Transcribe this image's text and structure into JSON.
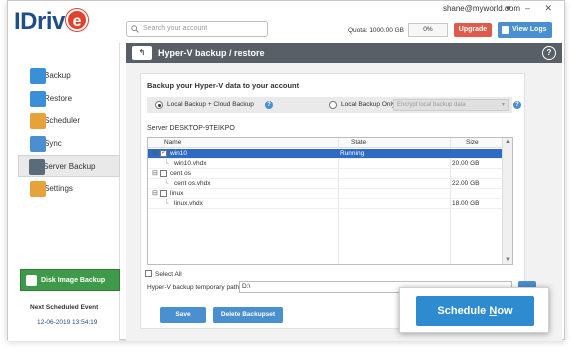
{
  "app": {
    "logo": "IDriv",
    "logo_e": "e"
  },
  "search": {
    "placeholder": "Search your account"
  },
  "account": {
    "email": "shane@myworld.com",
    "window_controls": "▾ – ✕"
  },
  "quota": {
    "label": "Quota: 1000.00 GB",
    "percent": "0%"
  },
  "buttons": {
    "upgrade": "Upgrade",
    "view_logs": "View Logs"
  },
  "sidebar": {
    "items": [
      {
        "label": "Backup",
        "icon": "backup-icon",
        "color": "#3a8fd6"
      },
      {
        "label": "Restore",
        "icon": "restore-icon",
        "color": "#3a8fd6"
      },
      {
        "label": "Scheduler",
        "icon": "scheduler-icon",
        "color": "#e7a23a"
      },
      {
        "label": "Sync",
        "icon": "sync-icon",
        "color": "#4a8fd0"
      },
      {
        "label": "Server Backup",
        "icon": "server-icon",
        "color": "#5a6b7a",
        "active": true
      },
      {
        "label": "Settings",
        "icon": "gear-icon",
        "color": "#e7a23a"
      }
    ],
    "disk_image": "Disk Image Backup",
    "next_scheduled_label": "Next Scheduled Event",
    "next_scheduled_date": "12-06-2019 13:54:19"
  },
  "header": {
    "title": "Hyper-V backup / restore",
    "back": "↰",
    "help": "?"
  },
  "content": {
    "title": "Backup your Hyper-V data to your account",
    "option1": "Local Backup + Cloud Backup",
    "option2": "Local Backup Only",
    "encrypt_select": "Encrypt local backup data",
    "server": "Server  DESKTOP-9TEIKPO",
    "columns": [
      "Name",
      "State",
      "Size"
    ],
    "rows": [
      {
        "name": "win10",
        "state": "Running",
        "size": "",
        "level": 0,
        "checked": true,
        "selected": true
      },
      {
        "name": "win10.vhdx",
        "state": "",
        "size": "20.00 GB",
        "level": 1
      },
      {
        "name": "cent os",
        "state": "",
        "size": "",
        "level": 0,
        "checked": false
      },
      {
        "name": "cent os.vhdx",
        "state": "",
        "size": "22.00 GB",
        "level": 1
      },
      {
        "name": "linux",
        "state": "",
        "size": "",
        "level": 0,
        "checked": false
      },
      {
        "name": "linux.vhdx",
        "state": "",
        "size": "18.00 GB",
        "level": 1
      }
    ],
    "select_all": "Select All",
    "path_label": "Hyper-V backup temporary path",
    "path_value": "D:\\",
    "save": "Save",
    "delete": "Delete Backupset"
  },
  "schedule": {
    "pre": "Schedule ",
    "u": "N",
    "post": "ow"
  }
}
